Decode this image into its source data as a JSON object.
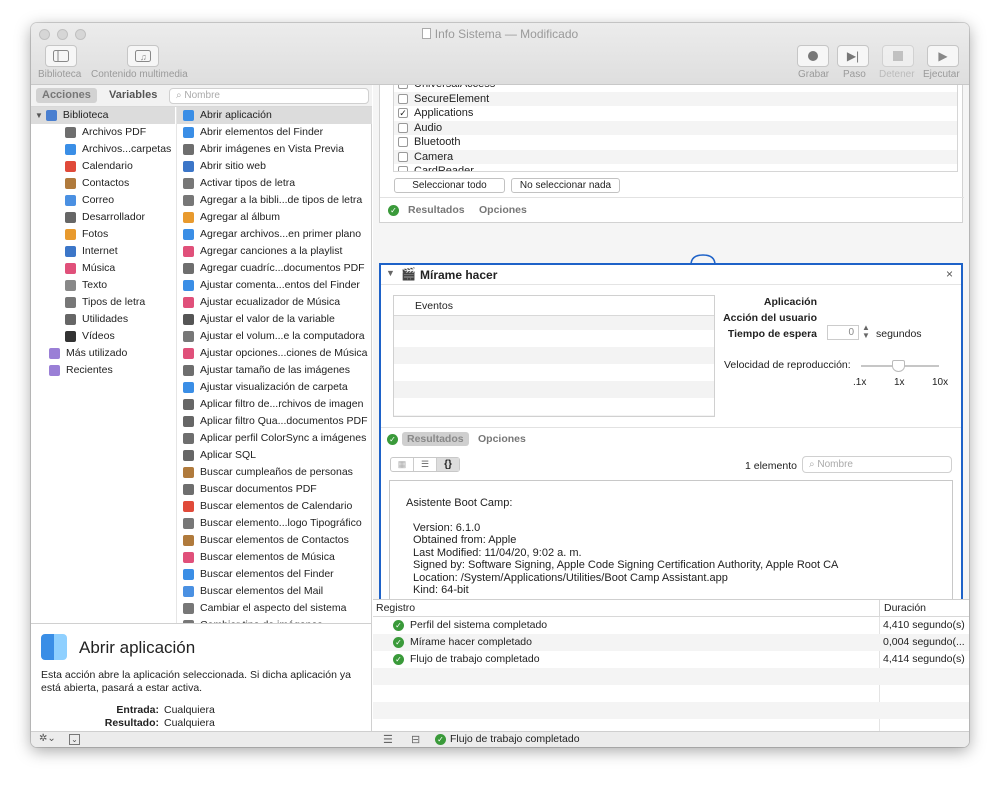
{
  "window": {
    "title": "Info Sistema",
    "status": "— Modificado"
  },
  "toolbar": {
    "library": "Biblioteca",
    "media": "Contenido multimedia",
    "record": "Grabar",
    "step": "Paso",
    "stop": "Detener",
    "run": "Ejecutar"
  },
  "left": {
    "tab_actions": "Acciones",
    "tab_variables": "Variables",
    "search_placeholder": "Nombre",
    "library": [
      {
        "label": "Biblioteca",
        "icon": "library-icon"
      },
      {
        "label": "Archivos PDF",
        "icon": "pdf-icon"
      },
      {
        "label": "Archivos...carpetas",
        "icon": "finder-icon"
      },
      {
        "label": "Calendario",
        "icon": "calendar-icon"
      },
      {
        "label": "Contactos",
        "icon": "contacts-icon"
      },
      {
        "label": "Correo",
        "icon": "mail-icon"
      },
      {
        "label": "Desarrollador",
        "icon": "developer-icon"
      },
      {
        "label": "Fotos",
        "icon": "photos-icon"
      },
      {
        "label": "Internet",
        "icon": "internet-icon"
      },
      {
        "label": "Música",
        "icon": "music-icon"
      },
      {
        "label": "Texto",
        "icon": "text-icon"
      },
      {
        "label": "Tipos de letra",
        "icon": "fonts-icon"
      },
      {
        "label": "Utilidades",
        "icon": "utilities-icon"
      },
      {
        "label": "Vídeos",
        "icon": "video-icon"
      },
      {
        "label": "Más utilizado",
        "icon": "folder-icon"
      },
      {
        "label": "Recientes",
        "icon": "folder-icon"
      }
    ],
    "actions": [
      "Abrir aplicación",
      "Abrir elementos del Finder",
      "Abrir imágenes en Vista Previa",
      "Abrir sitio web",
      "Activar tipos de letra",
      "Agregar a la bibli...de tipos de letra",
      "Agregar al álbum",
      "Agregar archivos...en primer plano",
      "Agregar canciones a la playlist",
      "Agregar cuadríc...documentos PDF",
      "Ajustar comenta...entos del Finder",
      "Ajustar ecualizador de Música",
      "Ajustar el valor de la variable",
      "Ajustar el volum...e la computadora",
      "Ajustar opciones...ciones de Música",
      "Ajustar tamaño de las imágenes",
      "Ajustar visualización de carpeta",
      "Aplicar filtro de...rchivos de imagen",
      "Aplicar filtro Qua...documentos PDF",
      "Aplicar perfil ColorSync a imágenes",
      "Aplicar SQL",
      "Buscar cumpleaños de personas",
      "Buscar documentos PDF",
      "Buscar elementos de Calendario",
      "Buscar elemento...logo Tipográfico",
      "Buscar elementos de Contactos",
      "Buscar elementos de Música",
      "Buscar elementos del Finder",
      "Buscar elementos del Mail",
      "Cambiar el aspecto del sistema",
      "Cambiar tipo de imágenes"
    ]
  },
  "info": {
    "title": "Abrir aplicación",
    "description": "Esta acción abre la aplicación seleccionada. Si dicha aplicación ya está abierta, pasará a estar activa.",
    "input_label": "Entrada:",
    "input_value": "Cualquiera",
    "result_label": "Resultado:",
    "result_value": "Cualquiera"
  },
  "profile_card": {
    "items": [
      {
        "label": "UniversalAccess",
        "checked": false
      },
      {
        "label": "SecureElement",
        "checked": false
      },
      {
        "label": "Applications",
        "checked": true
      },
      {
        "label": "Audio",
        "checked": false
      },
      {
        "label": "Bluetooth",
        "checked": false
      },
      {
        "label": "Camera",
        "checked": false
      },
      {
        "label": "CardReader",
        "checked": false
      }
    ],
    "select_all": "Seleccionar todo",
    "select_none": "No seleccionar nada",
    "results": "Resultados",
    "options": "Opciones"
  },
  "watch_card": {
    "title": "Mírame hacer",
    "events_header": "Eventos",
    "app_label": "Aplicación",
    "user_action_label": "Acción del usuario",
    "wait_label": "Tiempo de espera",
    "wait_value": "0",
    "seconds": "segundos",
    "speed_label": "Velocidad de reproducción:",
    "speed_ticks": [
      ".1x",
      "1x",
      "10x"
    ],
    "results": "Resultados",
    "options": "Opciones",
    "count": "1 elemento",
    "search_placeholder": "Nombre",
    "output_title": "Asistente Boot Camp:",
    "output_lines": [
      "Version: 6.1.0",
      "Obtained from: Apple",
      "Last Modified: 11/04/20, 9:02 a. m.",
      "Signed by: Software Signing, Apple Code Signing Certification Authority, Apple Root CA",
      "Location: /System/Applications/Utilities/Boot Camp Assistant.app",
      "Kind: 64-bit"
    ]
  },
  "log": {
    "col_registry": "Registro",
    "col_duration": "Duración",
    "rows": [
      {
        "label": "Perfil del sistema completado",
        "duration": "4,410 segundo(s)"
      },
      {
        "label": "Mírame hacer completado",
        "duration": "0,004 segundo(..."
      },
      {
        "label": "Flujo de trabajo completado",
        "duration": "4,414 segundo(s)"
      }
    ]
  },
  "status": {
    "text": "Flujo de trabajo completado"
  },
  "colors": {
    "accent": "#1e62c8",
    "success": "#3a9a3a"
  }
}
